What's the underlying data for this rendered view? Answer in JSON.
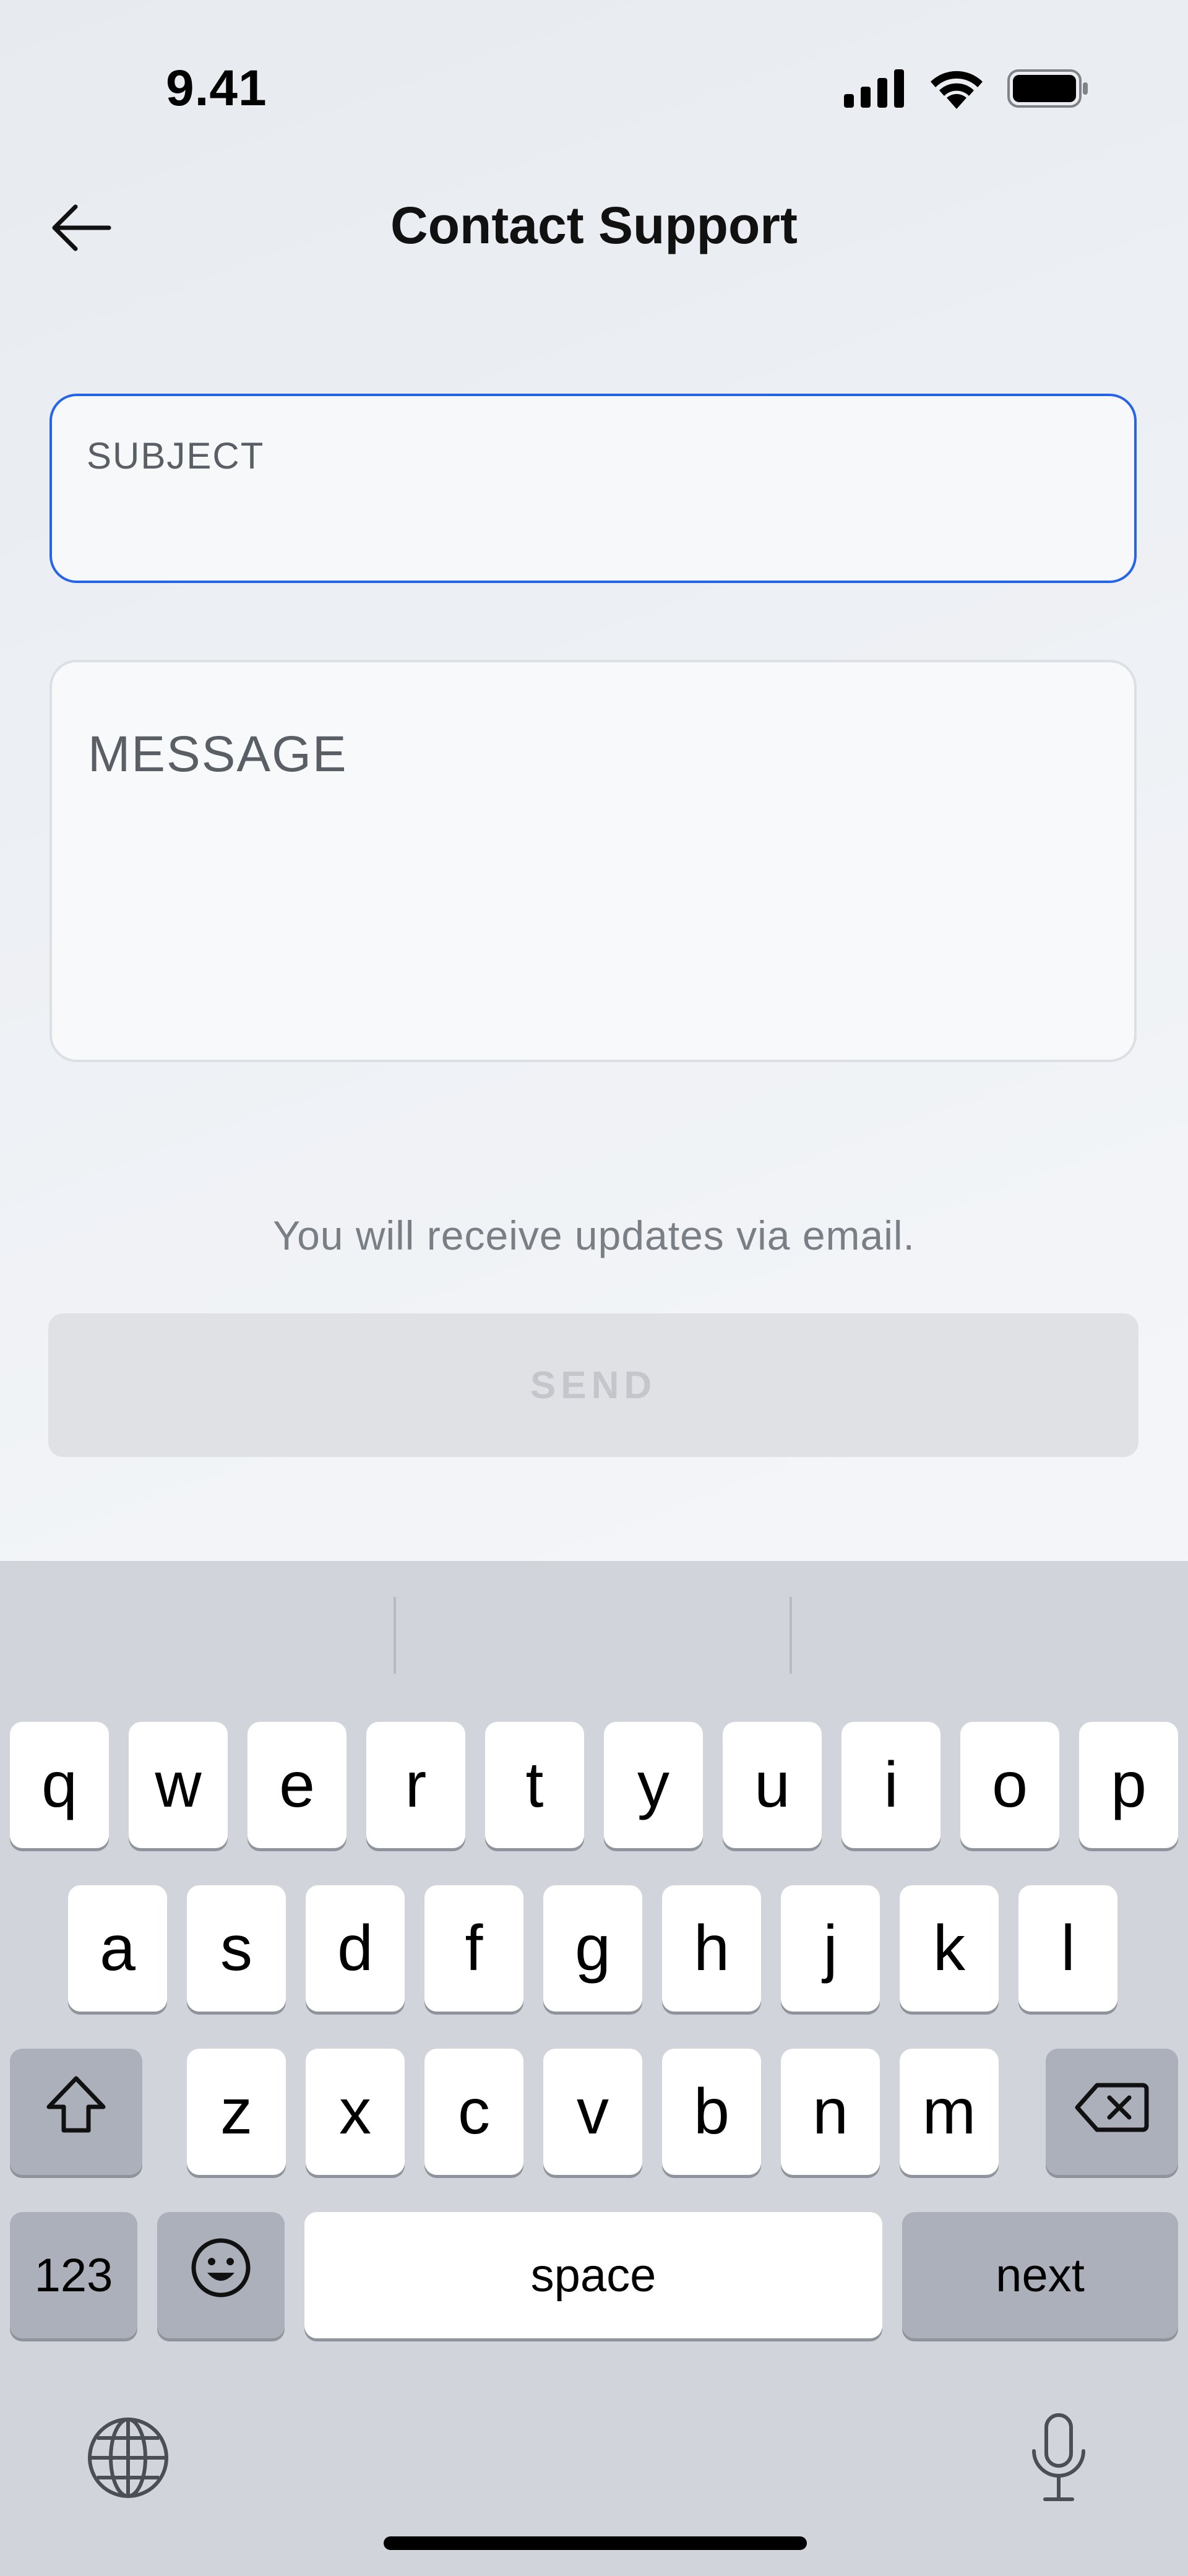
{
  "status_bar": {
    "time": "9.41",
    "icons": [
      "cellular-signal-icon",
      "wifi-icon",
      "battery-icon"
    ]
  },
  "header": {
    "back_icon": "arrow-left-icon",
    "title": "Contact Support"
  },
  "form": {
    "subject": {
      "label": "SUBJECT",
      "value": ""
    },
    "message": {
      "placeholder": "MESSAGE",
      "value": ""
    },
    "helper_text": "You will receive updates via email.",
    "send_label": "SEND"
  },
  "keyboard": {
    "row1": [
      "q",
      "w",
      "e",
      "r",
      "t",
      "y",
      "u",
      "i",
      "o",
      "p"
    ],
    "row2": [
      "a",
      "s",
      "d",
      "f",
      "g",
      "h",
      "j",
      "k",
      "l"
    ],
    "row3": [
      "z",
      "x",
      "c",
      "v",
      "b",
      "n",
      "m"
    ],
    "numbers_label": "123",
    "space_label": "space",
    "next_label": "next",
    "icons": [
      "shift-icon",
      "backspace-icon",
      "emoji-icon",
      "globe-icon",
      "microphone-icon"
    ]
  },
  "colors": {
    "accent": "#2563eb",
    "keyboard_bg": "#d1d4db",
    "disabled_button": "#e0e1e5"
  }
}
